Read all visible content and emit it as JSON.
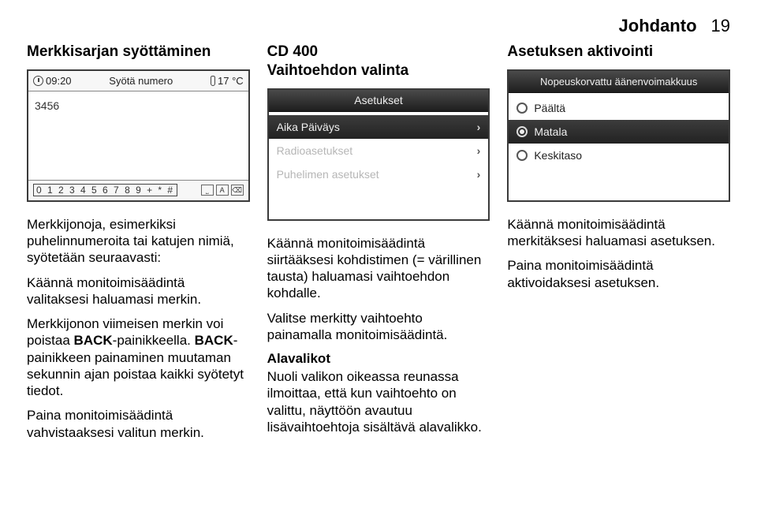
{
  "header": {
    "title": "Johdanto",
    "page": "19"
  },
  "col1": {
    "heading": "Merkkisarjan syöttäminen",
    "screenshot": {
      "time": "09:20",
      "title": "Syötä numero",
      "temp": "17 °C",
      "entered": "3456",
      "keyrow": "0 1 2 3 4 5 6 7 8 9 + * #",
      "icons": [
        "⎵",
        "A",
        "⌫"
      ]
    },
    "p1": "Merkkijonoja, esimerkiksi puhelinnumeroita tai katujen nimiä, syötetään seuraavasti:",
    "p2": "Käännä monitoimisäädintä valitaksesi haluamasi merkin.",
    "p3a": "Merkkijonon viimeisen merkin voi poistaa ",
    "p3b": "BACK",
    "p3c": "-painikkeella. ",
    "p3d": "BACK",
    "p3e": "-painikkeen painaminen muutaman sekunnin ajan poistaa kaikki syötetyt tiedot.",
    "p4": "Paina monitoimisäädintä vahvistaaksesi valitun merkin."
  },
  "col2": {
    "heading": "CD 400\nVaihtoehdon valinta",
    "screenshot": {
      "title": "Asetukset",
      "rows": [
        {
          "label": "Aika Päiväys",
          "selected": true
        },
        {
          "label": "Radioasetukset",
          "selected": false,
          "faded": true
        },
        {
          "label": "Puhelimen asetukset",
          "selected": false,
          "faded": true
        }
      ]
    },
    "p1": "Käännä monitoimisäädintä siirtääksesi kohdistimen (= värillinen tausta) haluamasi vaihtoehdon kohdalle.",
    "p2": "Valitse merkitty vaihtoehto painamalla monitoimisäädintä.",
    "subhead": "Alavalikot",
    "p3": "Nuoli valikon oikeassa reunassa ilmoittaa, että kun vaihtoehto on valittu, näyttöön avautuu lisävaihtoehtoja sisältävä alavalikko."
  },
  "col3": {
    "heading": "Asetuksen aktivointi",
    "screenshot": {
      "title": "Nopeuskorvattu äänenvoimakkuus",
      "rows": [
        {
          "label": "Päältä",
          "checked": false,
          "selected": false
        },
        {
          "label": "Matala",
          "checked": true,
          "selected": true
        },
        {
          "label": "Keskitaso",
          "checked": false,
          "selected": false
        }
      ]
    },
    "p1": "Käännä monitoimisäädintä merkitäksesi haluamasi asetuksen.",
    "p2": "Paina monitoimisäädintä aktivoidaksesi asetuksen."
  }
}
